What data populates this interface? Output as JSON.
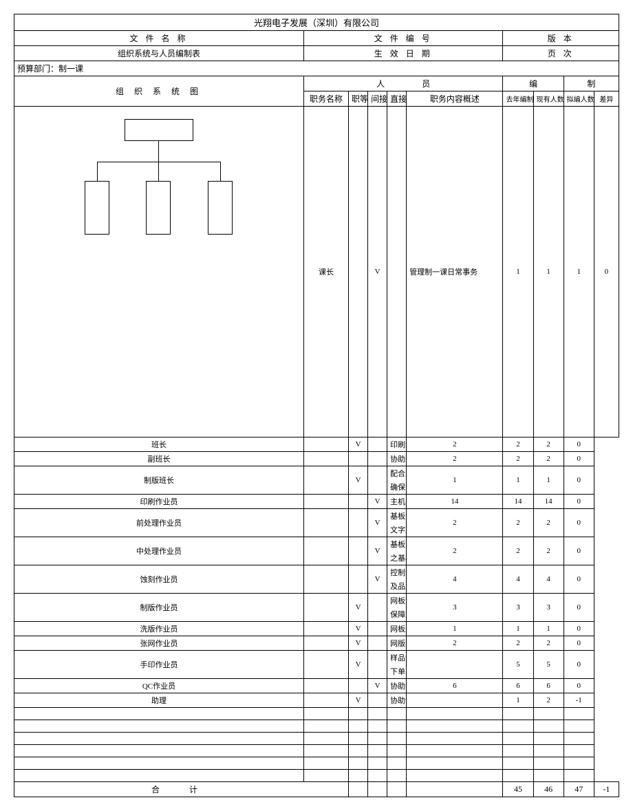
{
  "company": "光翔电子发展（深圳）有限公司",
  "doc_header": {
    "file_name_label": "文 件 名 称",
    "file_no_label": "文 件 编 号",
    "version_label": "版   本",
    "doc_title": "组织系统与人员编制表",
    "effective_date_label": "生 效 日 期",
    "page_label": "页   次"
  },
  "budget_dept_label": "预算部门：制一课",
  "org_chart_label": "组  织  系  统  图",
  "staff_header": {
    "p1": "人",
    "p2": "员",
    "p3": "编",
    "p4": "制"
  },
  "columns": {
    "job_name": "职务名称",
    "grade": "职等",
    "indirect": "间接",
    "direct": "直接",
    "desc": "职务内容概述",
    "last_year": "去年编制",
    "current": "现有人数",
    "planned": "拟编人数",
    "diff": "差异"
  },
  "rows": [
    {
      "job": "课长",
      "indirect": "V",
      "direct": "",
      "desc": "管理制一课日常事务",
      "last": 1,
      "curr": 1,
      "plan": 1,
      "diff": 0
    },
    {
      "job": "班长",
      "indirect": "V",
      "direct": "",
      "desc": "印刷线管制与调度",
      "last": 2,
      "curr": 2,
      "plan": 2,
      "diff": 0
    },
    {
      "job": "副班长",
      "indirect": "",
      "direct": "",
      "desc": "协助班长监督另一班次作业",
      "last": 2,
      "curr": 2,
      "plan": 2,
      "diff": 0
    },
    {
      "job": "制版班长",
      "indirect": "V",
      "direct": "",
      "desc": "配合生管计划，协调生产线，确保计划目标达成",
      "last": 1,
      "curr": 1,
      "plan": 1,
      "diff": 0
    },
    {
      "job": "印刷作业员",
      "indirect": "",
      "direct": "V",
      "desc": "主机手操作，提升绩效品质",
      "last": 14,
      "curr": 14,
      "plan": 14,
      "diff": 0
    },
    {
      "job": "前处理作业员",
      "indirect": "",
      "direct": "V",
      "desc": "基板清洗，收送线路站，文字站基板",
      "last": 2,
      "curr": 2,
      "plan": 2,
      "diff": 0
    },
    {
      "job": "中处理作业员",
      "indirect": "",
      "direct": "V",
      "desc": "基板清洗，收送防焊站之基板",
      "last": 2,
      "curr": 2,
      "plan": 2,
      "diff": 0
    },
    {
      "job": "蚀刻作业员",
      "indirect": "",
      "direct": "V",
      "desc": "控制液比重，稳定蚀速及品质",
      "last": 4,
      "curr": 4,
      "plan": 4,
      "diff": 0
    },
    {
      "job": "制版作业员",
      "indirect": "V",
      "direct": "",
      "desc": "网板制作、检查与维护，保障生产",
      "last": 3,
      "curr": 3,
      "plan": 3,
      "diff": 0
    },
    {
      "job": "洗版作业员",
      "indirect": "V",
      "direct": "",
      "desc": "网板剥膜，清洗，破网登录",
      "last": 1,
      "curr": 1,
      "plan": 1,
      "diff": 0
    },
    {
      "job": "张网作业员",
      "indirect": "V",
      "direct": "",
      "desc": "网版控制并登录",
      "last": 2,
      "curr": 2,
      "plan": 2,
      "diff": 0
    },
    {
      "job": "手印作业员",
      "indirect": "V",
      "direct": "",
      "desc": "样品制作，不良品，下单品制作",
      "last": "",
      "curr": 5,
      "plan": 5,
      "diff": 0
    },
    {
      "job": "QC作业员",
      "indirect": "",
      "direct": "V",
      "desc": "协助线印人员作品质监督控",
      "last": 6,
      "curr": 6,
      "plan": 6,
      "diff": 0
    },
    {
      "job": "助理",
      "indirect": "V",
      "direct": "",
      "desc": "协助课长工作",
      "last": "",
      "curr": 1,
      "plan": 2,
      "diff": -1
    }
  ],
  "totals": {
    "label": "合          计",
    "last": 45,
    "curr": 46,
    "plan": 47,
    "diff": -1
  }
}
